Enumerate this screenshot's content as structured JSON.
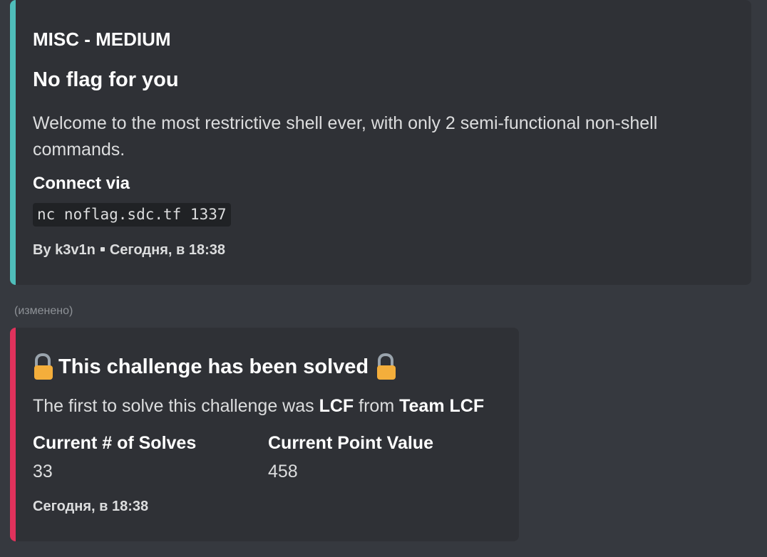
{
  "challenge": {
    "category": "MISC - MEDIUM",
    "title": "No flag for you",
    "description": "Welcome to the most restrictive shell ever, with only 2 semi-functional non-shell commands.",
    "connect_label": "Connect via",
    "connect_command": "nc noflag.sdc.tf 1337",
    "author": "By k3v1n",
    "timestamp": "Сегодня, в 18:38",
    "accent_color": "#4fbdba"
  },
  "edited_label": "(изменено)",
  "solved": {
    "title": "This challenge has been solved",
    "first_prefix": "The first to solve this challenge was",
    "first_solver": "LCF",
    "from_word": "from",
    "team": "Team LCF",
    "fields": [
      {
        "name": "Current # of Solves",
        "value": "33"
      },
      {
        "name": "Current Point Value",
        "value": "458"
      }
    ],
    "timestamp": "Сегодня, в 18:38",
    "accent_color": "#e0325c",
    "icons": [
      "unlocked-lock-icon",
      "unlocked-lock-icon"
    ]
  }
}
